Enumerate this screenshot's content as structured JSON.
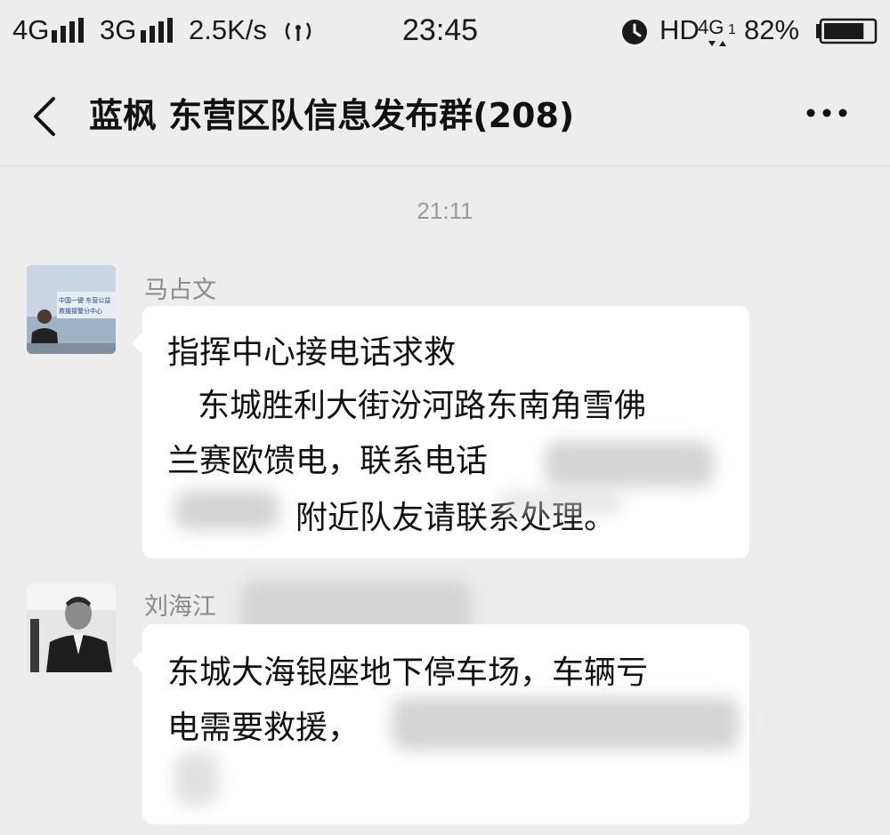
{
  "status_bar": {
    "network_1": "4G",
    "network_2": "3G",
    "speed": "2.5K/s",
    "time": "23:45",
    "hd": "HD",
    "net_badge": "4G",
    "net_badge_sub": "1",
    "battery_percent": "82%",
    "battery_level": 0.82
  },
  "header": {
    "title": "蓝枫 东营区队信息发布群(208)"
  },
  "conversation": {
    "timestamp": "21:11",
    "messages": [
      {
        "sender": "马占文",
        "avatar_text_1": "中国一键·东营公益",
        "avatar_text_2": "救援接警分中心",
        "lines": [
          "指挥中心接电话求救",
          "东城胜利大街汾河路东南角雪佛",
          "兰赛欧馈电，联系电话",
          "附近队友请联系处理。"
        ]
      },
      {
        "sender": "刘海江",
        "lines": [
          "东城大海银座地下停车场，车辆亏",
          "电需要救援，"
        ]
      }
    ]
  },
  "colors": {
    "background": "#ededed",
    "bubble": "#ffffff",
    "meta_text": "#8a8a8a"
  }
}
